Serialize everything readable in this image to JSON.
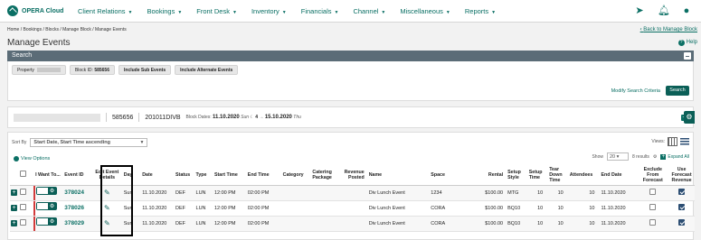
{
  "app": {
    "logo_text": "OPERA Cloud"
  },
  "menu": [
    "Client Relations",
    "Bookings",
    "Front Desk",
    "Inventory",
    "Financials",
    "Channel",
    "Miscellaneous",
    "Reports"
  ],
  "breadcrumb": "Home / Bookings / Blocks / Manage Block / Manage Events",
  "back_link": "Back to Manage Block",
  "page_title": "Manage Events",
  "help": "Help",
  "search": {
    "header": "Search",
    "property_label": "Property",
    "block_id_label": "Block ID:",
    "block_id_value": "585656",
    "include_sub": "Include Sub Events",
    "include_alt": "Include Alternate Events",
    "modify_link": "Modify Search Criteria",
    "search_button": "Search"
  },
  "block": {
    "id": "585656",
    "code": "201011DIVB",
    "dates_label": "Block Dates:",
    "start": "11.10.2020",
    "start_day": "Sun",
    "nights": "4",
    "end": "15.10.2020",
    "end_day": "Thu"
  },
  "list": {
    "sort_label": "Sort By",
    "sort_value": "Start Date, Start Time ascending",
    "views_label": "Views:",
    "view_options": "View Options",
    "show_label": "Show",
    "show_value": "20",
    "results": "8 results",
    "expand_all": "Expand All",
    "columns": [
      "I Want To...",
      "Event ID",
      "Edit Event Details",
      "Day",
      "Date",
      "Status",
      "Type",
      "Start Time",
      "End Time",
      "Category",
      "Catering Package",
      "Revenue Posted",
      "Name",
      "Space",
      "Rental",
      "Setup Style",
      "Setup Time",
      "Tear Down Time",
      "Attendees",
      "End Date",
      "Exclude From Forecast",
      "Use Forecast Revenue"
    ],
    "rows": [
      {
        "id": "378024",
        "day": "Sun",
        "date": "11.10.2020",
        "status": "DEF",
        "type": "LUN",
        "start": "12:00 PM",
        "end": "02:00 PM",
        "category": "",
        "catering": "",
        "revenue": "",
        "name": "Div Lunch Event",
        "space": "1234",
        "rental": "$100.00",
        "setup": "MTG",
        "setup_time": "10",
        "teardown": "10",
        "attendees": "10",
        "end_date": "11.10.2020"
      },
      {
        "id": "378026",
        "day": "Sun",
        "date": "11.10.2020",
        "status": "DEF",
        "type": "LUN",
        "start": "12:00 PM",
        "end": "02:00 PM",
        "category": "",
        "catering": "",
        "revenue": "",
        "name": "Div Lunch Event",
        "space": "CORA",
        "rental": "$100.00",
        "setup": "BQ10",
        "setup_time": "10",
        "teardown": "10",
        "attendees": "10",
        "end_date": "11.10.2020"
      },
      {
        "id": "378029",
        "day": "Sun",
        "date": "11.10.2020",
        "status": "DEF",
        "type": "LUN",
        "start": "12:00 PM",
        "end": "02:00 PM",
        "category": "",
        "catering": "",
        "revenue": "",
        "name": "Div Lunch Event",
        "space": "CORA",
        "rental": "$100.00",
        "setup": "BQ10",
        "setup_time": "10",
        "teardown": "10",
        "attendees": "10",
        "end_date": "11.10.2020"
      }
    ]
  },
  "colors": {
    "brand": "#0a6f64",
    "header_bar": "#5b6c77",
    "accent_red": "#d23b3b"
  }
}
